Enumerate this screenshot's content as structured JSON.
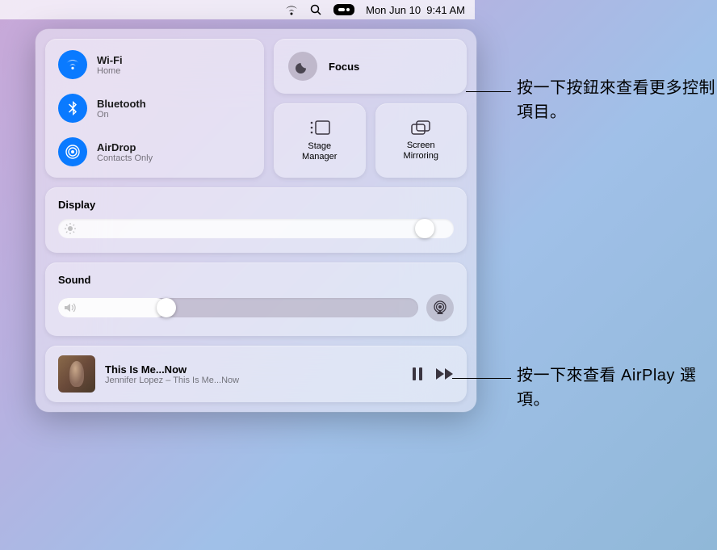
{
  "menubar": {
    "date": "Mon Jun 10",
    "time": "9:41 AM"
  },
  "connectivity": {
    "wifi": {
      "title": "Wi-Fi",
      "status": "Home"
    },
    "bluetooth": {
      "title": "Bluetooth",
      "status": "On"
    },
    "airdrop": {
      "title": "AirDrop",
      "status": "Contacts Only"
    }
  },
  "focus": {
    "label": "Focus"
  },
  "stage_manager": {
    "label": "Stage\nManager"
  },
  "screen_mirroring": {
    "label": "Screen\nMirroring"
  },
  "display": {
    "label": "Display",
    "value": 95
  },
  "sound": {
    "label": "Sound",
    "value": 30
  },
  "media": {
    "title": "This Is Me...Now",
    "artist": "Jennifer Lopez – This Is Me...Now"
  },
  "callouts": {
    "focus": "按一下按鈕來查看更多控制項目。",
    "airplay": "按一下來查看 AirPlay 選項。"
  }
}
